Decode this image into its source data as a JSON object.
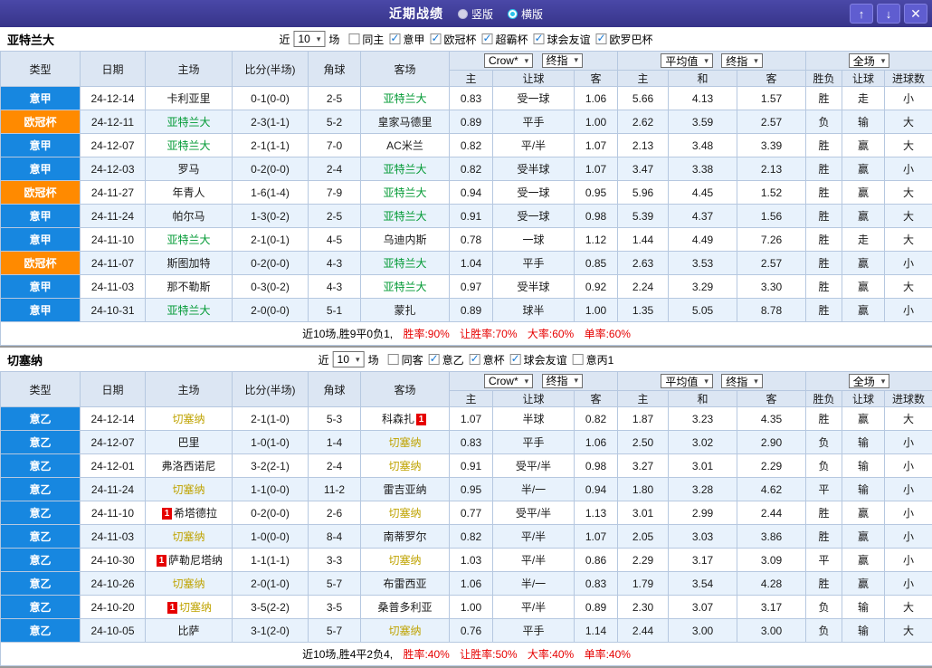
{
  "colors": {
    "topbar-bg": "#3e3c96",
    "btn-bg": "#5f5dd0",
    "radio-selected": "#29c3ea",
    "header-bg": "#dce6f3",
    "row-alt-bg": "#e8f2fc",
    "grid-border": "#b6c8e0",
    "league-blue": "#1787e0",
    "league-orange": "#ff8a00",
    "team1-color": "#009933",
    "team2-color": "#bfa300",
    "win-red": "#e60000",
    "lose-blue": "#0000d8",
    "draw-green": "#009933"
  },
  "topbar": {
    "title": "近期战绩",
    "view_modes": [
      {
        "label": "竖版",
        "selected": false
      },
      {
        "label": "横版",
        "selected": true
      }
    ],
    "up_button": "↑",
    "down_button": "↓",
    "close_button": "✕"
  },
  "tables": [
    {
      "team": "亚特兰大",
      "filter": {
        "prefix": "近",
        "count": "10",
        "suffix": "场",
        "checkboxes": [
          {
            "label": "同主",
            "checked": false
          },
          {
            "label": "意甲",
            "checked": true
          },
          {
            "label": "欧冠杯",
            "checked": true
          },
          {
            "label": "超霸杯",
            "checked": true
          },
          {
            "label": "球会友谊",
            "checked": true
          },
          {
            "label": "欧罗巴杯",
            "checked": true
          }
        ]
      },
      "header": {
        "cols": [
          "类型",
          "日期",
          "主场",
          "比分(半场)",
          "角球",
          "客场"
        ],
        "odds_source": "Crow*",
        "odds_final": "终指",
        "avg_label": "平均值",
        "avg_final": "终指",
        "scope": "全场",
        "sub": [
          "主",
          "让球",
          "客",
          "主",
          "和",
          "客",
          "胜负",
          "让球",
          "进球数"
        ]
      },
      "rows": [
        {
          "league": "意甲",
          "league_color": "blue",
          "date": "24-12-14",
          "home": {
            "name": "卡利亚里",
            "self": false
          },
          "score": "0-1(0-0)",
          "corner": "2-5",
          "away": {
            "name": "亚特兰大",
            "self": true
          },
          "odds": [
            "0.83",
            "受一球",
            "1.06"
          ],
          "avg": [
            "5.66",
            "4.13",
            "1.57"
          ],
          "result": {
            "text": "胜",
            "color": "red"
          },
          "handicap": {
            "text": "走",
            "color": "green"
          },
          "goals": {
            "text": "小",
            "color": "blue"
          }
        },
        {
          "league": "欧冠杯",
          "league_color": "orange",
          "date": "24-12-11",
          "home": {
            "name": "亚特兰大",
            "self": true
          },
          "score": "2-3(1-1)",
          "corner": "5-2",
          "away": {
            "name": "皇家马德里",
            "self": false
          },
          "odds": [
            "0.89",
            "平手",
            "1.00"
          ],
          "avg": [
            "2.62",
            "3.59",
            "2.57"
          ],
          "result": {
            "text": "负",
            "color": "blue"
          },
          "handicap": {
            "text": "输",
            "color": "blue"
          },
          "goals": {
            "text": "大",
            "color": "red"
          }
        },
        {
          "league": "意甲",
          "league_color": "blue",
          "date": "24-12-07",
          "home": {
            "name": "亚特兰大",
            "self": true
          },
          "score": "2-1(1-1)",
          "corner": "7-0",
          "away": {
            "name": "AC米兰",
            "self": false
          },
          "odds": [
            "0.82",
            "平/半",
            "1.07"
          ],
          "avg": [
            "2.13",
            "3.48",
            "3.39"
          ],
          "result": {
            "text": "胜",
            "color": "red"
          },
          "handicap": {
            "text": "赢",
            "color": "red"
          },
          "goals": {
            "text": "大",
            "color": "red"
          }
        },
        {
          "league": "意甲",
          "league_color": "blue",
          "date": "24-12-03",
          "home": {
            "name": "罗马",
            "self": false
          },
          "score": "0-2(0-0)",
          "corner": "2-4",
          "away": {
            "name": "亚特兰大",
            "self": true
          },
          "odds": [
            "0.82",
            "受半球",
            "1.07"
          ],
          "avg": [
            "3.47",
            "3.38",
            "2.13"
          ],
          "result": {
            "text": "胜",
            "color": "red"
          },
          "handicap": {
            "text": "赢",
            "color": "red"
          },
          "goals": {
            "text": "小",
            "color": "blue"
          }
        },
        {
          "league": "欧冠杯",
          "league_color": "orange",
          "date": "24-11-27",
          "home": {
            "name": "年青人",
            "self": false
          },
          "score": "1-6(1-4)",
          "corner": "7-9",
          "away": {
            "name": "亚特兰大",
            "self": true
          },
          "odds": [
            "0.94",
            "受一球",
            "0.95"
          ],
          "avg": [
            "5.96",
            "4.45",
            "1.52"
          ],
          "result": {
            "text": "胜",
            "color": "red"
          },
          "handicap": {
            "text": "赢",
            "color": "red"
          },
          "goals": {
            "text": "大",
            "color": "red"
          }
        },
        {
          "league": "意甲",
          "league_color": "blue",
          "date": "24-11-24",
          "home": {
            "name": "帕尔马",
            "self": false
          },
          "score": "1-3(0-2)",
          "corner": "2-5",
          "away": {
            "name": "亚特兰大",
            "self": true
          },
          "odds": [
            "0.91",
            "受一球",
            "0.98"
          ],
          "avg": [
            "5.39",
            "4.37",
            "1.56"
          ],
          "result": {
            "text": "胜",
            "color": "red"
          },
          "handicap": {
            "text": "赢",
            "color": "red"
          },
          "goals": {
            "text": "大",
            "color": "red"
          }
        },
        {
          "league": "意甲",
          "league_color": "blue",
          "date": "24-11-10",
          "home": {
            "name": "亚特兰大",
            "self": true
          },
          "score": "2-1(0-1)",
          "corner": "4-5",
          "away": {
            "name": "乌迪内斯",
            "self": false
          },
          "odds": [
            "0.78",
            "一球",
            "1.12"
          ],
          "avg": [
            "1.44",
            "4.49",
            "7.26"
          ],
          "result": {
            "text": "胜",
            "color": "red"
          },
          "handicap": {
            "text": "走",
            "color": "green"
          },
          "goals": {
            "text": "大",
            "color": "red"
          }
        },
        {
          "league": "欧冠杯",
          "league_color": "orange",
          "date": "24-11-07",
          "home": {
            "name": "斯图加特",
            "self": false
          },
          "score": "0-2(0-0)",
          "corner": "4-3",
          "away": {
            "name": "亚特兰大",
            "self": true
          },
          "odds": [
            "1.04",
            "平手",
            "0.85"
          ],
          "avg": [
            "2.63",
            "3.53",
            "2.57"
          ],
          "result": {
            "text": "胜",
            "color": "red"
          },
          "handicap": {
            "text": "赢",
            "color": "red"
          },
          "goals": {
            "text": "小",
            "color": "blue"
          }
        },
        {
          "league": "意甲",
          "league_color": "blue",
          "date": "24-11-03",
          "home": {
            "name": "那不勒斯",
            "self": false
          },
          "score": "0-3(0-2)",
          "corner": "4-3",
          "away": {
            "name": "亚特兰大",
            "self": true
          },
          "odds": [
            "0.97",
            "受半球",
            "0.92"
          ],
          "avg": [
            "2.24",
            "3.29",
            "3.30"
          ],
          "result": {
            "text": "胜",
            "color": "red"
          },
          "handicap": {
            "text": "赢",
            "color": "red"
          },
          "goals": {
            "text": "大",
            "color": "red"
          }
        },
        {
          "league": "意甲",
          "league_color": "blue",
          "date": "24-10-31",
          "home": {
            "name": "亚特兰大",
            "self": true
          },
          "score": "2-0(0-0)",
          "corner": "5-1",
          "away": {
            "name": "蒙扎",
            "self": false
          },
          "odds": [
            "0.89",
            "球半",
            "1.00"
          ],
          "avg": [
            "1.35",
            "5.05",
            "8.78"
          ],
          "result": {
            "text": "胜",
            "color": "red"
          },
          "handicap": {
            "text": "赢",
            "color": "red"
          },
          "goals": {
            "text": "小",
            "color": "blue"
          }
        }
      ],
      "summary": {
        "prefix": "近10场,胜9平0负1,",
        "rates": [
          "胜率:90%",
          "让胜率:70%",
          "大率:60%",
          "单率:60%"
        ]
      }
    },
    {
      "team": "切塞纳",
      "filter": {
        "prefix": "近",
        "count": "10",
        "suffix": "场",
        "checkboxes": [
          {
            "label": "同客",
            "checked": false
          },
          {
            "label": "意乙",
            "checked": true
          },
          {
            "label": "意杯",
            "checked": true
          },
          {
            "label": "球会友谊",
            "checked": true
          },
          {
            "label": "意丙1",
            "checked": false
          }
        ]
      },
      "header": {
        "cols": [
          "类型",
          "日期",
          "主场",
          "比分(半场)",
          "角球",
          "客场"
        ],
        "odds_source": "Crow*",
        "odds_final": "终指",
        "avg_label": "平均值",
        "avg_final": "终指",
        "scope": "全场",
        "sub": [
          "主",
          "让球",
          "客",
          "主",
          "和",
          "客",
          "胜负",
          "让球",
          "进球数"
        ]
      },
      "rows": [
        {
          "league": "意乙",
          "league_color": "blue",
          "date": "24-12-14",
          "home": {
            "name": "切塞纳",
            "self": true
          },
          "score": "2-1(1-0)",
          "corner": "5-3",
          "away": {
            "name": "科森扎",
            "self": false,
            "badge": "1",
            "badge_pos": "after"
          },
          "odds": [
            "1.07",
            "半球",
            "0.82"
          ],
          "avg": [
            "1.87",
            "3.23",
            "4.35"
          ],
          "result": {
            "text": "胜",
            "color": "red"
          },
          "handicap": {
            "text": "赢",
            "color": "red"
          },
          "goals": {
            "text": "大",
            "color": "red"
          }
        },
        {
          "league": "意乙",
          "league_color": "blue",
          "date": "24-12-07",
          "home": {
            "name": "巴里",
            "self": false
          },
          "score": "1-0(1-0)",
          "corner": "1-4",
          "away": {
            "name": "切塞纳",
            "self": true
          },
          "odds": [
            "0.83",
            "平手",
            "1.06"
          ],
          "avg": [
            "2.50",
            "3.02",
            "2.90"
          ],
          "result": {
            "text": "负",
            "color": "blue"
          },
          "handicap": {
            "text": "输",
            "color": "blue"
          },
          "goals": {
            "text": "小",
            "color": "blue"
          }
        },
        {
          "league": "意乙",
          "league_color": "blue",
          "date": "24-12-01",
          "home": {
            "name": "弗洛西诺尼",
            "self": false
          },
          "score": "3-2(2-1)",
          "corner": "2-4",
          "away": {
            "name": "切塞纳",
            "self": true
          },
          "odds": [
            "0.91",
            "受平/半",
            "0.98"
          ],
          "avg": [
            "3.27",
            "3.01",
            "2.29"
          ],
          "result": {
            "text": "负",
            "color": "blue"
          },
          "handicap": {
            "text": "输",
            "color": "blue"
          },
          "goals": {
            "text": "小",
            "color": "blue"
          }
        },
        {
          "league": "意乙",
          "league_color": "blue",
          "date": "24-11-24",
          "home": {
            "name": "切塞纳",
            "self": true
          },
          "score": "1-1(0-0)",
          "corner": "11-2",
          "away": {
            "name": "雷吉亚纳",
            "self": false
          },
          "odds": [
            "0.95",
            "半/一",
            "0.94"
          ],
          "avg": [
            "1.80",
            "3.28",
            "4.62"
          ],
          "result": {
            "text": "平",
            "color": "green"
          },
          "handicap": {
            "text": "输",
            "color": "blue"
          },
          "goals": {
            "text": "小",
            "color": "blue"
          }
        },
        {
          "league": "意乙",
          "league_color": "blue",
          "date": "24-11-10",
          "home": {
            "name": "希塔德拉",
            "self": false,
            "badge": "1",
            "badge_pos": "before"
          },
          "score": "0-2(0-0)",
          "corner": "2-6",
          "away": {
            "name": "切塞纳",
            "self": true
          },
          "odds": [
            "0.77",
            "受平/半",
            "1.13"
          ],
          "avg": [
            "3.01",
            "2.99",
            "2.44"
          ],
          "result": {
            "text": "胜",
            "color": "red"
          },
          "handicap": {
            "text": "赢",
            "color": "red"
          },
          "goals": {
            "text": "小",
            "color": "blue"
          }
        },
        {
          "league": "意乙",
          "league_color": "blue",
          "date": "24-11-03",
          "home": {
            "name": "切塞纳",
            "self": true
          },
          "score": "1-0(0-0)",
          "corner": "8-4",
          "away": {
            "name": "南蒂罗尔",
            "self": false
          },
          "odds": [
            "0.82",
            "平/半",
            "1.07"
          ],
          "avg": [
            "2.05",
            "3.03",
            "3.86"
          ],
          "result": {
            "text": "胜",
            "color": "red"
          },
          "handicap": {
            "text": "赢",
            "color": "red"
          },
          "goals": {
            "text": "小",
            "color": "blue"
          }
        },
        {
          "league": "意乙",
          "league_color": "blue",
          "date": "24-10-30",
          "home": {
            "name": "萨勒尼塔纳",
            "self": false,
            "badge": "1",
            "badge_pos": "before"
          },
          "score": "1-1(1-1)",
          "corner": "3-3",
          "away": {
            "name": "切塞纳",
            "self": true
          },
          "odds": [
            "1.03",
            "平/半",
            "0.86"
          ],
          "avg": [
            "2.29",
            "3.17",
            "3.09"
          ],
          "result": {
            "text": "平",
            "color": "green"
          },
          "handicap": {
            "text": "赢",
            "color": "red"
          },
          "goals": {
            "text": "小",
            "color": "blue"
          }
        },
        {
          "league": "意乙",
          "league_color": "blue",
          "date": "24-10-26",
          "home": {
            "name": "切塞纳",
            "self": true
          },
          "score": "2-0(1-0)",
          "corner": "5-7",
          "away": {
            "name": "布雷西亚",
            "self": false
          },
          "odds": [
            "1.06",
            "半/一",
            "0.83"
          ],
          "avg": [
            "1.79",
            "3.54",
            "4.28"
          ],
          "result": {
            "text": "胜",
            "color": "red"
          },
          "handicap": {
            "text": "赢",
            "color": "red"
          },
          "goals": {
            "text": "小",
            "color": "blue"
          }
        },
        {
          "league": "意乙",
          "league_color": "blue",
          "date": "24-10-20",
          "home": {
            "name": "切塞纳",
            "self": true,
            "badge": "1",
            "badge_pos": "before"
          },
          "score": "3-5(2-2)",
          "corner": "3-5",
          "away": {
            "name": "桑普多利亚",
            "self": false
          },
          "odds": [
            "1.00",
            "平/半",
            "0.89"
          ],
          "avg": [
            "2.30",
            "3.07",
            "3.17"
          ],
          "result": {
            "text": "负",
            "color": "blue"
          },
          "handicap": {
            "text": "输",
            "color": "blue"
          },
          "goals": {
            "text": "大",
            "color": "red"
          }
        },
        {
          "league": "意乙",
          "league_color": "blue",
          "date": "24-10-05",
          "home": {
            "name": "比萨",
            "self": false
          },
          "score": "3-1(2-0)",
          "corner": "5-7",
          "away": {
            "name": "切塞纳",
            "self": true
          },
          "odds": [
            "0.76",
            "平手",
            "1.14"
          ],
          "avg": [
            "2.44",
            "3.00",
            "3.00"
          ],
          "result": {
            "text": "负",
            "color": "blue"
          },
          "handicap": {
            "text": "输",
            "color": "blue"
          },
          "goals": {
            "text": "大",
            "color": "red"
          }
        }
      ],
      "summary": {
        "prefix": "近10场,胜4平2负4,",
        "rates": [
          "胜率:40%",
          "让胜率:50%",
          "大率:40%",
          "单率:40%"
        ]
      }
    }
  ]
}
